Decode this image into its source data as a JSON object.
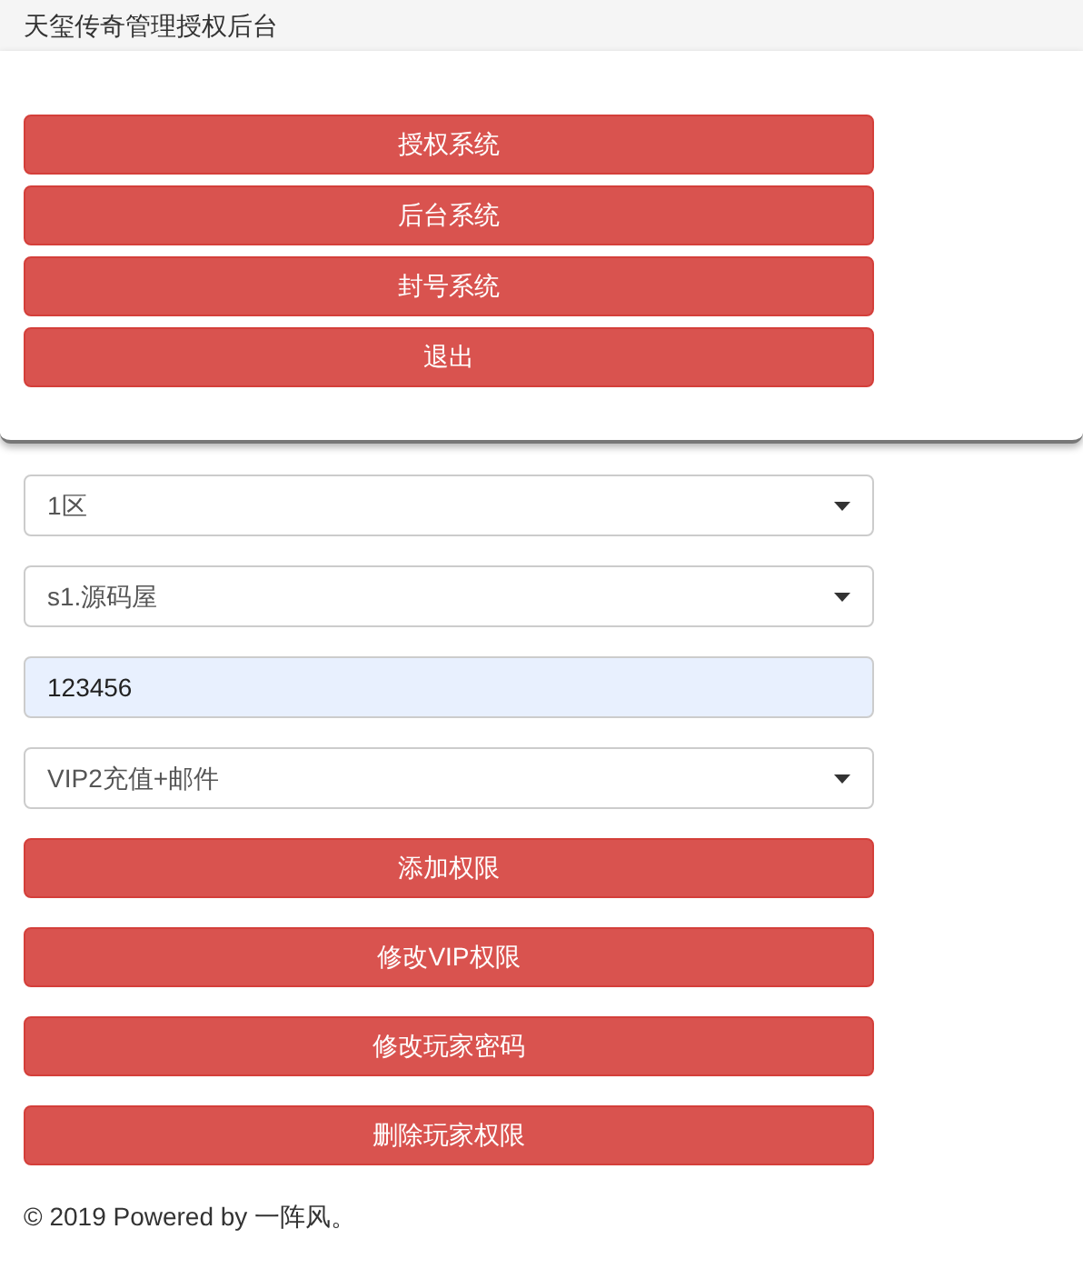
{
  "header": {
    "title": "天玺传奇管理授权后台"
  },
  "menu_buttons": [
    "授权系统",
    "后台系统",
    "封号系统",
    "退出"
  ],
  "form_fields": [
    {
      "kind": "select",
      "value": "1区"
    },
    {
      "kind": "select",
      "value": "s1.源码屋"
    },
    {
      "kind": "input",
      "value": "123456"
    },
    {
      "kind": "select",
      "value": "VIP2充值+邮件"
    }
  ],
  "action_buttons": [
    "添加权限",
    "修改VIP权限",
    "修改玩家密码",
    "删除玩家权限"
  ],
  "footer": "© 2019 Powered by 一阵风。"
}
